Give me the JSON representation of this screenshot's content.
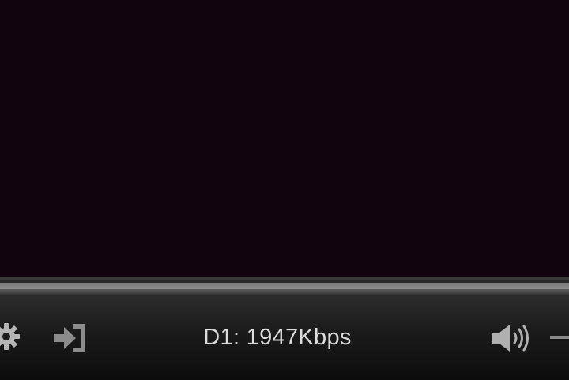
{
  "player": {
    "bitrate_label": "D1: 1947Kbps"
  },
  "icons": {
    "settings": "gear-icon",
    "exit": "sign-in-icon",
    "volume": "speaker-icon"
  },
  "colors": {
    "video_background": "#11040f",
    "control_bar": "#1c1c1c",
    "icon": "#a8a8a8",
    "text": "#dcdcdc"
  }
}
